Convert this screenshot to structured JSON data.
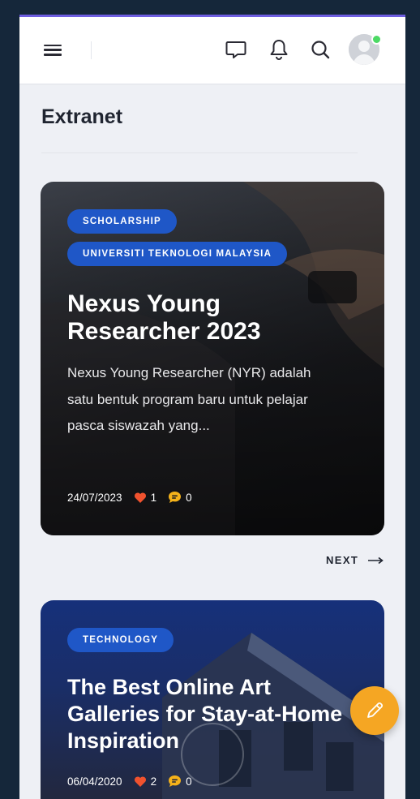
{
  "header": {
    "menu_icon": "hamburger-menu-icon",
    "icons": [
      "chat-icon",
      "bell-icon",
      "search-icon"
    ],
    "avatar": "user-avatar",
    "online_color": "#4cd964"
  },
  "page": {
    "title": "Extranet"
  },
  "cards": [
    {
      "badges": [
        "SCHOLARSHIP",
        "UNIVERSITI TEKNOLOGI MALAYSIA"
      ],
      "title": "Nexus Young Researcher 2023",
      "excerpt": "Nexus Young Researcher (NYR) adalah satu bentuk program baru untuk pelajar pasca siswazah yang...",
      "date": "24/07/2023",
      "likes": "1",
      "comments": "0"
    },
    {
      "badges": [
        "TECHNOLOGY"
      ],
      "title": "The Best Online Art Galleries for Stay-at-Home Inspiration",
      "date": "06/04/2020",
      "likes": "2",
      "comments": "0"
    }
  ],
  "pager": {
    "next_label": "NEXT"
  },
  "fab": {
    "icon": "pencil-icon"
  },
  "colors": {
    "badge": "#1f57c7",
    "accent_line": "#6e5ee0",
    "heart": "#f0522e",
    "comment": "#f5b21a",
    "fab": "#f5a623"
  }
}
